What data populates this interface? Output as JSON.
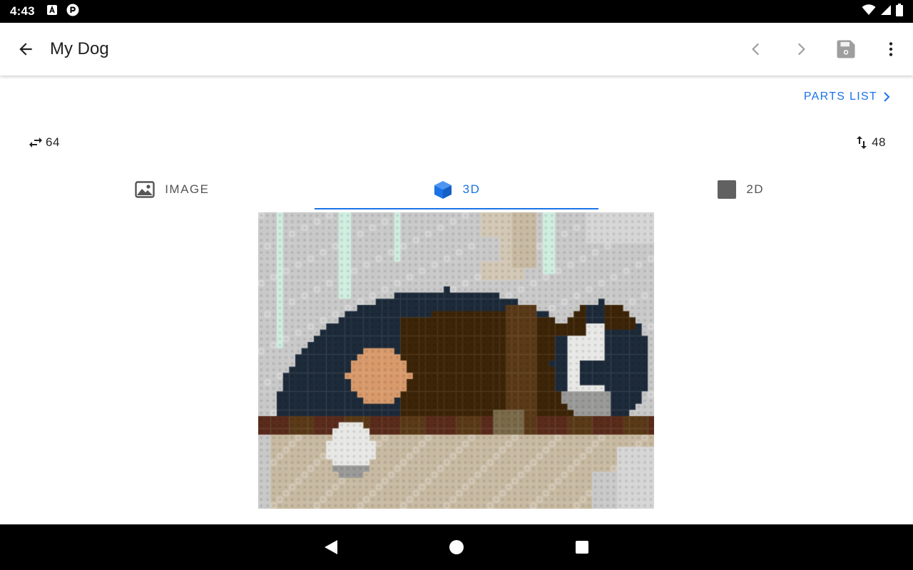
{
  "status": {
    "time": "4:43"
  },
  "appbar": {
    "title": "My Dog"
  },
  "parts_link": {
    "label": "PARTS LIST"
  },
  "dimensions": {
    "width": "64",
    "height": "48"
  },
  "tabs": [
    {
      "label": "IMAGE",
      "icon": "image-icon",
      "active": false
    },
    {
      "label": "3D",
      "icon": "cube-icon",
      "active": true
    },
    {
      "label": "2D",
      "icon": "square-icon",
      "active": false
    }
  ],
  "colors": {
    "accent": "#1a73e8",
    "text": "#212121",
    "muted": "#555555"
  }
}
